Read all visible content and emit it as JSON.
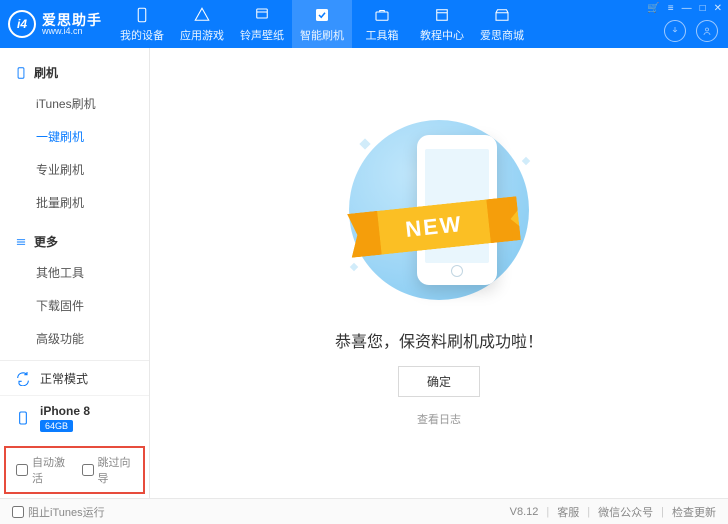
{
  "app": {
    "name": "爱思助手",
    "url": "www.i4.cn",
    "logo_text": "i4"
  },
  "nav": {
    "items": [
      {
        "label": "我的设备",
        "icon": "device"
      },
      {
        "label": "应用游戏",
        "icon": "app"
      },
      {
        "label": "铃声壁纸",
        "icon": "music"
      },
      {
        "label": "智能刷机",
        "icon": "flash",
        "active": true
      },
      {
        "label": "工具箱",
        "icon": "toolbox"
      },
      {
        "label": "教程中心",
        "icon": "book"
      },
      {
        "label": "爱思商城",
        "icon": "store"
      }
    ]
  },
  "sidebar": {
    "groups": [
      {
        "title": "刷机",
        "icon": "phone",
        "items": [
          "iTunes刷机",
          "一键刷机",
          "专业刷机",
          "批量刷机"
        ],
        "active_index": 1
      },
      {
        "title": "更多",
        "icon": "more",
        "items": [
          "其他工具",
          "下载固件",
          "高级功能"
        ],
        "active_index": -1
      }
    ],
    "status": {
      "label": "正常模式"
    },
    "device": {
      "name": "iPhone 8",
      "storage": "64GB"
    },
    "checks": {
      "auto_activate": "自动激活",
      "skip_guide": "跳过向导"
    }
  },
  "main": {
    "ribbon": "NEW",
    "success": "恭喜您，保资料刷机成功啦！",
    "ok": "确定",
    "log": "查看日志"
  },
  "footer": {
    "block_itunes": "阻止iTunes运行",
    "version": "V8.12",
    "support": "客服",
    "wechat": "微信公众号",
    "update": "检查更新"
  }
}
